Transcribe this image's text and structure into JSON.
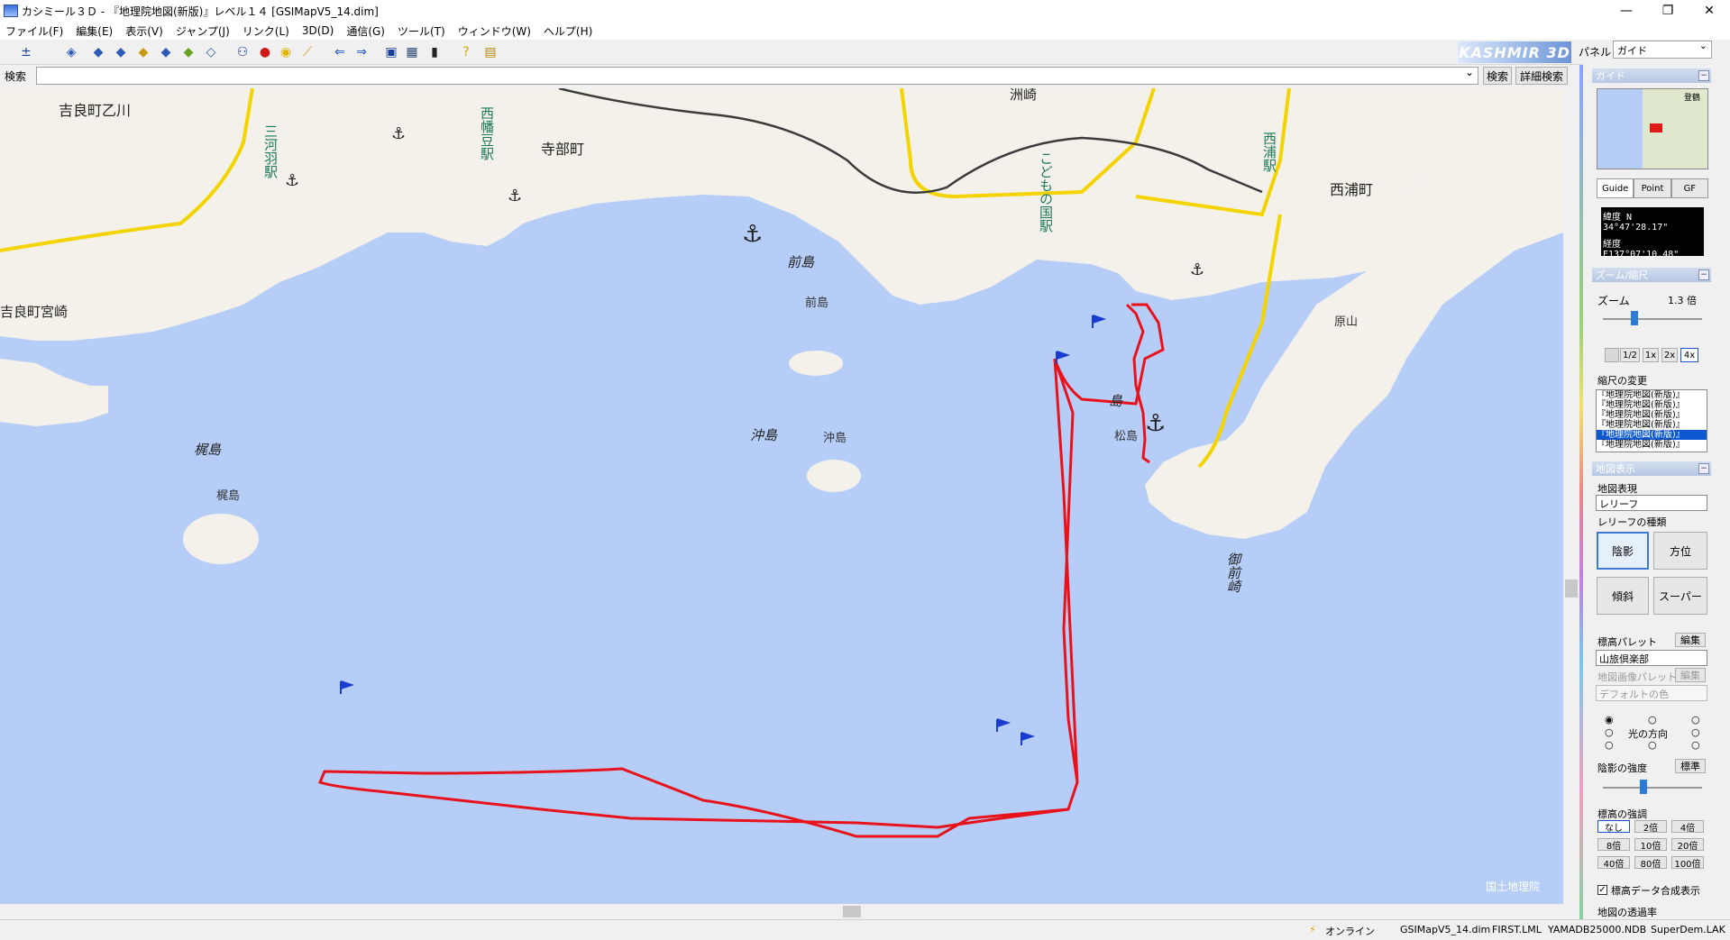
{
  "window": {
    "title": "カシミール３Ｄ - 『地理院地図(新版)』レベル１４ [GSIMapV5_14.dim]",
    "minimize": "—",
    "maximize": "❐",
    "close": "✕"
  },
  "menu": [
    "ファイル(F)",
    "編集(E)",
    "表示(V)",
    "ジャンプ(J)",
    "リンク(L)",
    "3D(D)",
    "通信(G)",
    "ツール(T)",
    "ウィンドウ(W)",
    "ヘルプ(H)"
  ],
  "toolbar": {
    "brand": "KASHMIR 3D",
    "panel_label": "パネル",
    "panel_value": "ガイド"
  },
  "search": {
    "label": "検索",
    "value": "",
    "search_button": "検索",
    "advanced_button": "詳細検索"
  },
  "map": {
    "attribution": "国土地理院",
    "labels": {
      "kiracho_otokawa": "吉良町乙川",
      "kiracho_miyazaki": "吉良町宮崎",
      "mikawa_haba": "三河羽駅",
      "nishihazu": "西幡豆駅",
      "terabe": "寺部町",
      "suzaki": "洲崎",
      "kodomo": "こどもの国駅",
      "nishiura_st": "西浦駅",
      "nishiura_cho": "西浦町",
      "mae_island": "前島",
      "mae_island_small": "前島",
      "oki_island": "沖島",
      "oki_island_small": "沖島",
      "kaji_island": "梶島",
      "kaji_island_small": "梶島",
      "matsu_island": "松島",
      "shima": "島",
      "hara_mountain": "原山",
      "gozen_cape": "御前崎"
    }
  },
  "panel": {
    "guide_header": "ガイド",
    "minimap_label": "登鶴",
    "tabs": [
      "Guide",
      "Point",
      "GF"
    ],
    "coords": {
      "lat_label": "緯度",
      "lat": "N 34°47'28.17\"",
      "lon_label": "経度",
      "lon": "E137°07'10.48\""
    },
    "zoom_header": "ズーム/縮尺",
    "zoom_label": "ズーム",
    "zoom_value": "1.3 倍",
    "zoom_level": 0.3,
    "zoom_buttons": [
      "1/2",
      "1x",
      "2x",
      "4x"
    ],
    "scale_change": "縮尺の変更",
    "scale_items": [
      "『地理院地図(新版)』",
      "『地理院地図(新版)』",
      "『地理院地図(新版)』",
      "『地理院地図(新版)』",
      "『地理院地図(新版)』",
      "『地理院地図(新版)』"
    ],
    "map_display_header": "地図表示",
    "map_expression": "地図表現",
    "expression_value": "レリーフ",
    "relief_type": "レリーフの種類",
    "relief_buttons": [
      "陰影",
      "方位",
      "傾斜",
      "スーパー"
    ],
    "elev_palette": "標高パレット",
    "edit1": "編集",
    "palette_value": "山旅倶楽部",
    "image_palette": "地図画像パレット",
    "edit2": "編集",
    "default_color": "デフォルトの色",
    "light_direction": "光の方向",
    "shade_strength": "陰影の強度",
    "standard": "標準",
    "shade_level": 0.4,
    "elev_emphasis": "標高の強調",
    "emphasis_buttons": [
      "なし",
      "2倍",
      "4倍",
      "8倍",
      "10倍",
      "20倍",
      "40倍",
      "80倍",
      "100倍"
    ],
    "elev_composite": "標高データ合成表示",
    "transparency": "地図の透過率"
  },
  "status": {
    "online": "オンライン",
    "file1": "GSIMapV5_14.dim",
    "file2": "FIRST.LML",
    "file3": "YAMADB25000.NDB",
    "file4": "SuperDem.LAK"
  },
  "colors": {
    "sea": "#b6cdf7",
    "land": "#f4f1ea",
    "track": "#e8121b",
    "road": "#f4d400",
    "rail": "#3b3b3b"
  }
}
